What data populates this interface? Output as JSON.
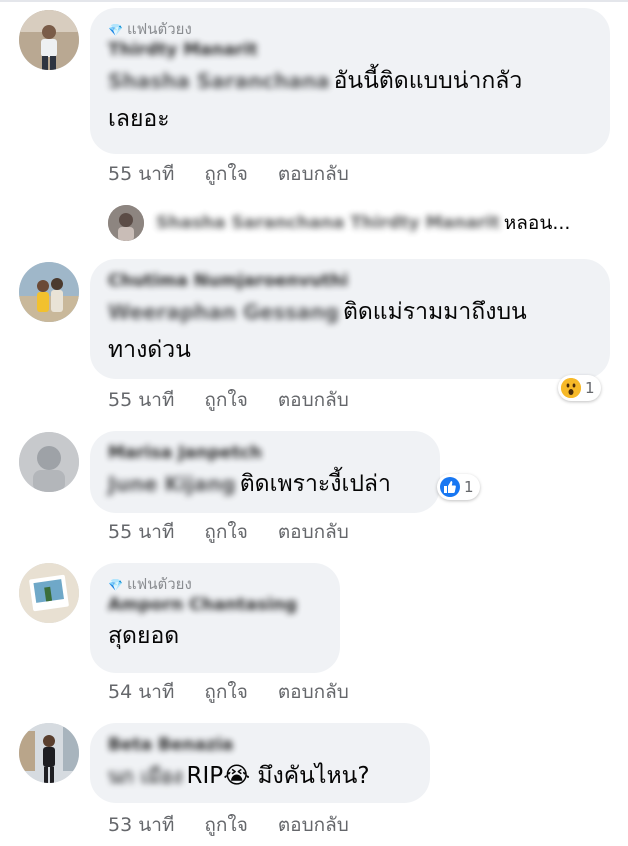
{
  "comments": [
    {
      "badge": "แฟนตัวยง",
      "names": [
        "Thirdty Manarit"
      ],
      "mention": "Shasha Saranchana",
      "text": "อันนี้ติดแบบน่ากลัวเลยอะ",
      "text_line1": "อันนี้ติดแบบน่ากลัว",
      "text_line2": "เลยอะ",
      "time": "55 นาที",
      "like": "ถูกใจ",
      "reply": "ตอบกลับ"
    },
    {
      "names": [
        "Chutima Numjaroenvuthi"
      ],
      "mention": "Weeraphan Gessang",
      "text_line1": "ติดแม่รามมาถึงบน",
      "text_line2": "ทางด่วน",
      "time": "55 นาที",
      "like": "ถูกใจ",
      "reply": "ตอบกลับ",
      "reaction": {
        "icon": "wow-emoji-icon",
        "count": "1"
      }
    },
    {
      "names": [
        "Marisa Janpetch"
      ],
      "mention": "June Kijang",
      "text_line1": "ติดเพราะงี้เปล่า",
      "time": "55 นาที",
      "like": "ถูกใจ",
      "reply": "ตอบกลับ",
      "reaction": {
        "icon": "like-icon",
        "count": "1"
      }
    },
    {
      "badge": "แฟนตัวยง",
      "names": [
        "Amporn Chantasing"
      ],
      "text_line1": "สุดยอด",
      "time": "54 นาที",
      "like": "ถูกใจ",
      "reply": "ตอบกลับ"
    },
    {
      "names": [
        "Beta Benazia"
      ],
      "mention": "นก เมือง",
      "text_pre": "RIP",
      "emoji": "😭",
      "text_post": " มึงคันไหน?",
      "time": "53 นาที",
      "like": "ถูกใจ",
      "reply": "ตอบกลับ"
    }
  ],
  "reply_preview": {
    "names": "Shasha Saranchana Thirdty Manarit",
    "text": "หลอน..."
  },
  "colors": {
    "bubble": "#f0f2f5",
    "meta": "#65676b",
    "like_blue": "#1877f2",
    "wow_yellow": "#f7b928"
  }
}
